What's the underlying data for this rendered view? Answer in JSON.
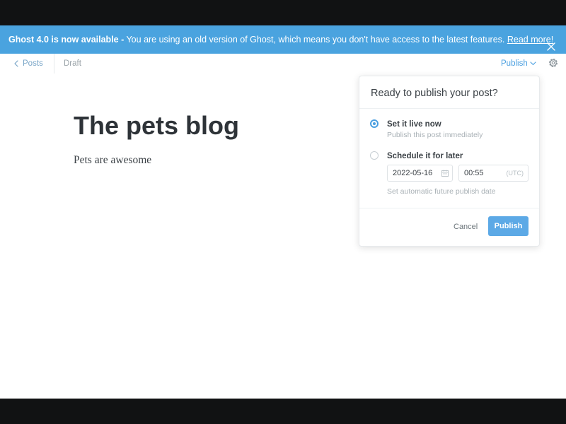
{
  "banner": {
    "strong_text": "Ghost 4.0 is now available -",
    "message": " You are using an old version of Ghost, which means you don't have access to the latest features. ",
    "link_text": "Read more!"
  },
  "topbar": {
    "back_label": "Posts",
    "status": "Draft",
    "publish_label": "Publish"
  },
  "post": {
    "title": "The pets blog",
    "body": "Pets are awesome"
  },
  "publish_menu": {
    "title": "Ready to publish your post?",
    "options": [
      {
        "label": "Set it live now",
        "description": "Publish this post immediately",
        "selected": true
      },
      {
        "label": "Schedule it for later",
        "description": "Set automatic future publish date",
        "selected": false
      }
    ],
    "date_value": "2022-05-16",
    "time_value": "00:55",
    "timezone": "(UTC)",
    "cancel_label": "Cancel",
    "publish_label": "Publish"
  },
  "colors": {
    "banner_bg": "#4aa3df",
    "accent": "#4a9fe0",
    "publish_button": "#5ca9e6"
  }
}
